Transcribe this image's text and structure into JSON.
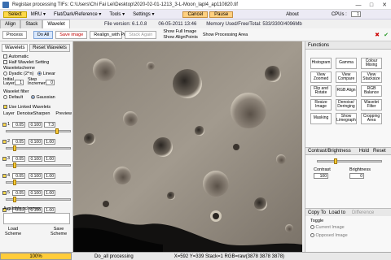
{
  "window": {
    "title": "Registax processing TIFs: C:\\Users\\Chi Fai Lei\\Desktop\\2020-02-01-1213_3-L-Moon_lapl4_ap110820.tif"
  },
  "menu": {
    "select": "Select",
    "mru": "MRU ▾",
    "flat_dark_ref": "Flat/Dark/Reference ▾",
    "tools": "Tools ▾",
    "settings": "Settings ▾",
    "cancel": "Cancel",
    "pause": "Pause",
    "about": "About",
    "cpus_label": "CPUs :",
    "cpus_value": "1"
  },
  "tabs": [
    "Align",
    "Stack",
    "Wavelet"
  ],
  "info": {
    "file_version": "File version: 6.1.0.8",
    "date": "06-05-2011 13:46",
    "memory": "Memory Used/Free/Total: 533/3300/4096Mb"
  },
  "toolbar": {
    "process": "Process",
    "do_all": "Do All",
    "save_image": "Save image",
    "realign": "Realign_with Processed",
    "stack_again": "Stack Again",
    "show_full_image": "Show Full Image",
    "show_align_points": "Show AlignPoints",
    "show_processing_area": "Show Processing Area"
  },
  "wavelets": {
    "tab_wavelets": "Wavelets",
    "tab_reset": "Reset Wavelets",
    "automatic": "Automatic",
    "half_wavelet": "Half Wavelet Setting",
    "wavelet_scheme": "Waveletscheme",
    "dyadic": "Dyadic (2^n)",
    "linear": "Linear",
    "initial_layer_label": "Initial Layer",
    "initial_layer_value": "1",
    "step_increment_label": "Step Increment",
    "step_increment_value": "0",
    "wavelet_filter": "Wavelet filter",
    "default": "Default",
    "gaussian": "Gaussian",
    "use_linked": "Use Linked Wavelets",
    "col_layer": "Layer",
    "col_denoise": "Denoise",
    "col_sharpen": "Sharpen",
    "col_preview": "Preview",
    "layers": [
      {
        "n": "1",
        "denoise": "0.05",
        "sharpen": "0.100",
        "preview": "7.3"
      },
      {
        "n": "2",
        "denoise": "0.05",
        "sharpen": "0.100",
        "preview": "1.00"
      },
      {
        "n": "3",
        "denoise": "0.05",
        "sharpen": "0.100",
        "preview": "1.00"
      },
      {
        "n": "4",
        "denoise": "0.05",
        "sharpen": "0.100",
        "preview": "1.00"
      },
      {
        "n": "5",
        "denoise": "0.05",
        "sharpen": "0.100",
        "preview": "1.00"
      },
      {
        "n": "6",
        "denoise": "0.05",
        "sharpen": "0.100",
        "preview": "1.00"
      }
    ],
    "available_schemes": "Available schemes",
    "load_scheme": "Load Scheme",
    "save_scheme": "Save Scheme"
  },
  "functions": {
    "title": "Functions",
    "buttons": [
      "Histogram",
      "Gamma",
      "Colour Mixing",
      "View Zoomed",
      "View Compare",
      "View Stacksize",
      "Flip and Rotate",
      "RGB Align",
      "RGB Balance",
      "Resize Image",
      "Denoise/ Deringing",
      "Wavelet Filter",
      "Masking",
      "Show Limegraph",
      "Cropping Area"
    ]
  },
  "contrast": {
    "title": "Contrast/Brightness",
    "hold": "Hold",
    "reset": "Reset",
    "contrast_label": "Contrast",
    "contrast_value": "100",
    "brightness_label": "Brightness",
    "brightness_value": "0"
  },
  "copyto": {
    "copy_to": "Copy To",
    "load_to": "Load to",
    "difference": "Difference",
    "toggle": "Toggle",
    "current_image": "Current Image",
    "opposed_image": "Opposed Image"
  },
  "status": {
    "progress_label": "100%",
    "progress_value": 1.0,
    "message": "Do_all processing",
    "coords": "X=592 Y=339 Stack=1 RGB=raw(3878 3878 3878)"
  }
}
